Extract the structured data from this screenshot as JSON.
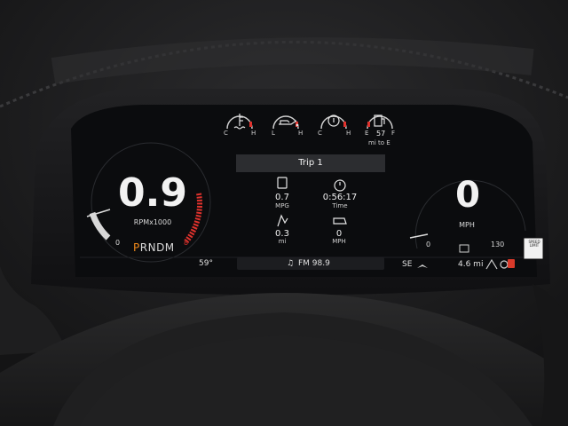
{
  "tach": {
    "value": "0.9",
    "unit": "RPMx1000",
    "min": "0",
    "max": "8"
  },
  "gear": {
    "selected": "P",
    "rest": "RNDM"
  },
  "gauges": {
    "coolant": {
      "low": "C",
      "high": "H"
    },
    "oil": {
      "low": "L",
      "high": "H"
    },
    "trans": {
      "low": "C",
      "high": "H"
    },
    "fuel": {
      "low": "E",
      "value": "57",
      "high": "F",
      "unit": "mi to E"
    }
  },
  "trip": {
    "title": "Trip 1",
    "mpg_value": "0.7",
    "mpg_label": "MPG",
    "time_value": "0:56:17",
    "time_label": "Time",
    "dist_value": "0.3",
    "dist_label": "mi",
    "speed_value": "0",
    "speed_label": "MPH"
  },
  "speedo": {
    "value": "0",
    "unit": "MPH",
    "min": "0",
    "max": "130"
  },
  "speed_limit": {
    "label": "SPEED LIMIT"
  },
  "status_bar": {
    "temp": "59°",
    "radio": "FM 98.9",
    "heading": "SE",
    "distance": "4.6 mi"
  },
  "colors": {
    "screen": "#0b0c0e",
    "redline": "#e0322d",
    "gear_selected": "#f28a1a",
    "warning_red": "#d93a2a"
  }
}
